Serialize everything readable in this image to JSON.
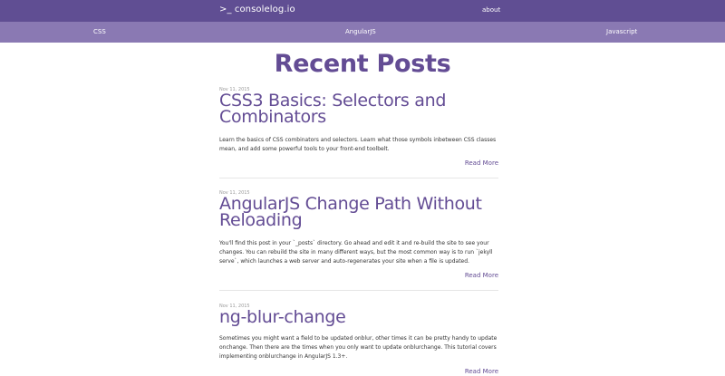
{
  "header": {
    "brand": ">_ consolelog.io",
    "about": "about"
  },
  "categories": [
    "CSS",
    "AngularJS",
    "Javascript"
  ],
  "main": {
    "title": "Recent Posts"
  },
  "posts": [
    {
      "date": "Nov 11, 2015",
      "title": "CSS3 Basics: Selectors and Combinators",
      "excerpt": "Learn the basics of CSS combinators and selectors. Learn what those symbols inbetween CSS classes mean, and add some powerful tools to your front-end toolbelt.",
      "read_more": "Read More"
    },
    {
      "date": "Nov 11, 2015",
      "title": "AngularJS Change Path Without Reloading",
      "excerpt": "You'll find this post in your `_posts` directory. Go ahead and edit it and re-build the site to see your changes. You can rebuild the site in many different ways, but the most common way is to run `jekyll serve`, which launches a web server and auto-regenerates your site when a file is updated.",
      "read_more": "Read More"
    },
    {
      "date": "Nov 11, 2015",
      "title": "ng-blur-change",
      "excerpt": "Sometimes you might want a field to be updated onblur, other times it can be pretty handy to update onchange. Then there are the times when you only want to update onblurchange. This tutorial covers implementing onblurchange in AngularJS 1.3+.",
      "read_more": "Read More"
    }
  ]
}
